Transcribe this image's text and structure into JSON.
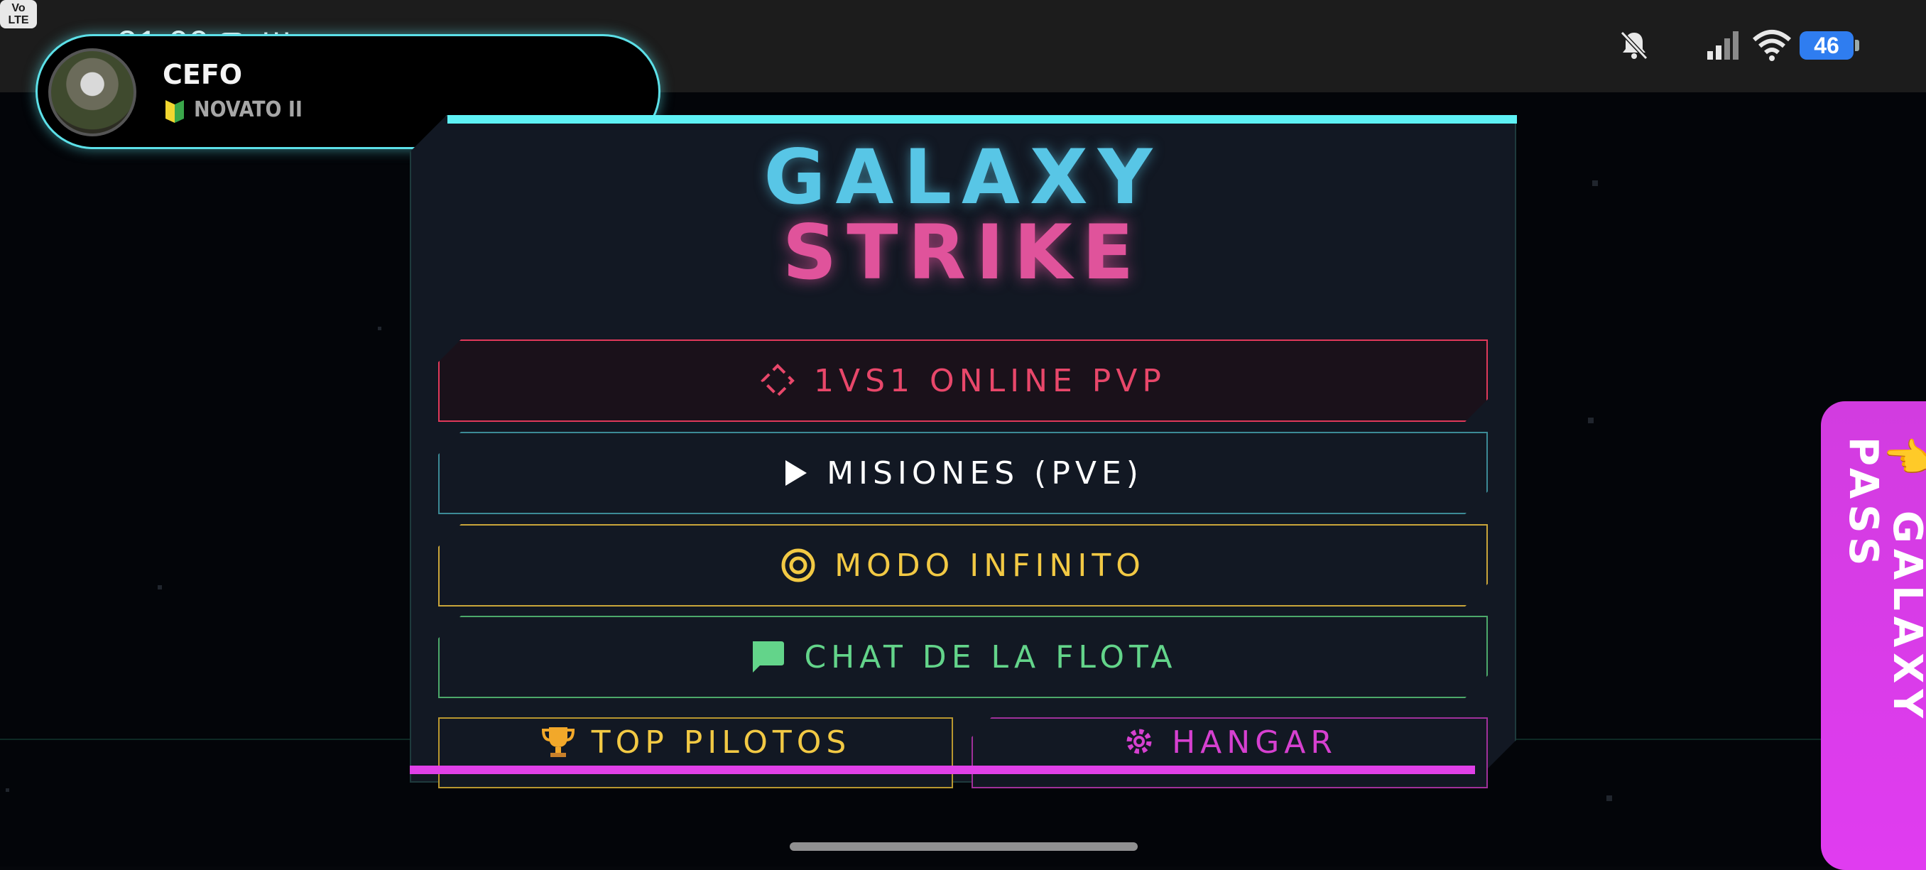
{
  "status_bar": {
    "time": "21:09",
    "more": "···",
    "volte": "Vo LTE",
    "battery": "46",
    "icons": [
      "instagram-icon",
      "bell-off-icon",
      "volte-icon",
      "signal-icon",
      "wifi-icon",
      "battery-icon"
    ]
  },
  "profile": {
    "username": "CEFO",
    "rank": "NOVATO II",
    "rank_icon": "beginner-badge-icon"
  },
  "title": {
    "line1": "GALAXY",
    "line2": "STRIKE"
  },
  "menu": {
    "pvp": {
      "label": "1VS1 ONLINE PVP",
      "icon": "swords-icon",
      "color": "#e8476a"
    },
    "pve": {
      "label": "MISIONES (PVE)",
      "icon": "play-icon",
      "color": "#ffffff"
    },
    "infinite": {
      "label": "MODO INFINITO",
      "icon": "target-icon",
      "color": "#f2c944"
    },
    "chat": {
      "label": "CHAT DE LA FLOTA",
      "icon": "chat-bubble-icon",
      "color": "#63d48a"
    },
    "top": {
      "label": "TOP PILOTOS",
      "icon": "trophy-icon",
      "color": "#f2c944"
    },
    "hangar": {
      "label": "HANGAR",
      "icon": "gear-icon",
      "color": "#d640d0"
    }
  },
  "pass_tab": {
    "label": "👈 GALAXY\nPASS"
  },
  "colors": {
    "accent_cyan": "#5ef1f5",
    "accent_magenta": "#e040e8",
    "background": "#030509"
  }
}
